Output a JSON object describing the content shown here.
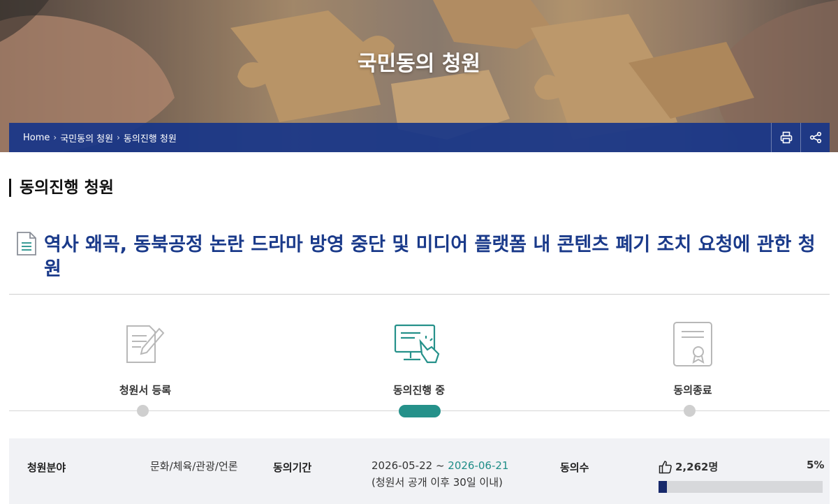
{
  "hero": {
    "title": "국민동의 청원",
    "breadcrumbs": [
      "Home",
      "국민동의 청원",
      "동의진행 청원"
    ],
    "separator": "›",
    "bar_color": "#173589"
  },
  "section": {
    "title": "동의진행 청원"
  },
  "petition": {
    "title": "역사 왜곡, 동북공정 논란 드라마 방영 중단 및 미디어 플랫폼 내 콘텐츠 폐기 조치 요청에 관한 청원",
    "title_color": "#1a3a8a"
  },
  "steps": [
    {
      "label": "청원서 등록",
      "icon": "document-pen-icon",
      "status": "done"
    },
    {
      "label": "동의진행 중",
      "icon": "monitor-click-icon",
      "status": "current"
    },
    {
      "label": "동의종료",
      "icon": "certificate-icon",
      "status": "pending"
    }
  ],
  "info": {
    "category_label": "청원분야",
    "category_value": "문화/체육/관광/언론",
    "period_label": "동의기간",
    "period_start": "2026-05-22",
    "period_sep": " ~ ",
    "period_end": "2026-06-21",
    "period_note": "(청원서 공개 이후 30일 이내)",
    "count_label": "동의수",
    "count_value": "2,262명",
    "progress_percent_text": "5%",
    "progress_fraction": 0.05,
    "accent_color": "#25918a"
  }
}
